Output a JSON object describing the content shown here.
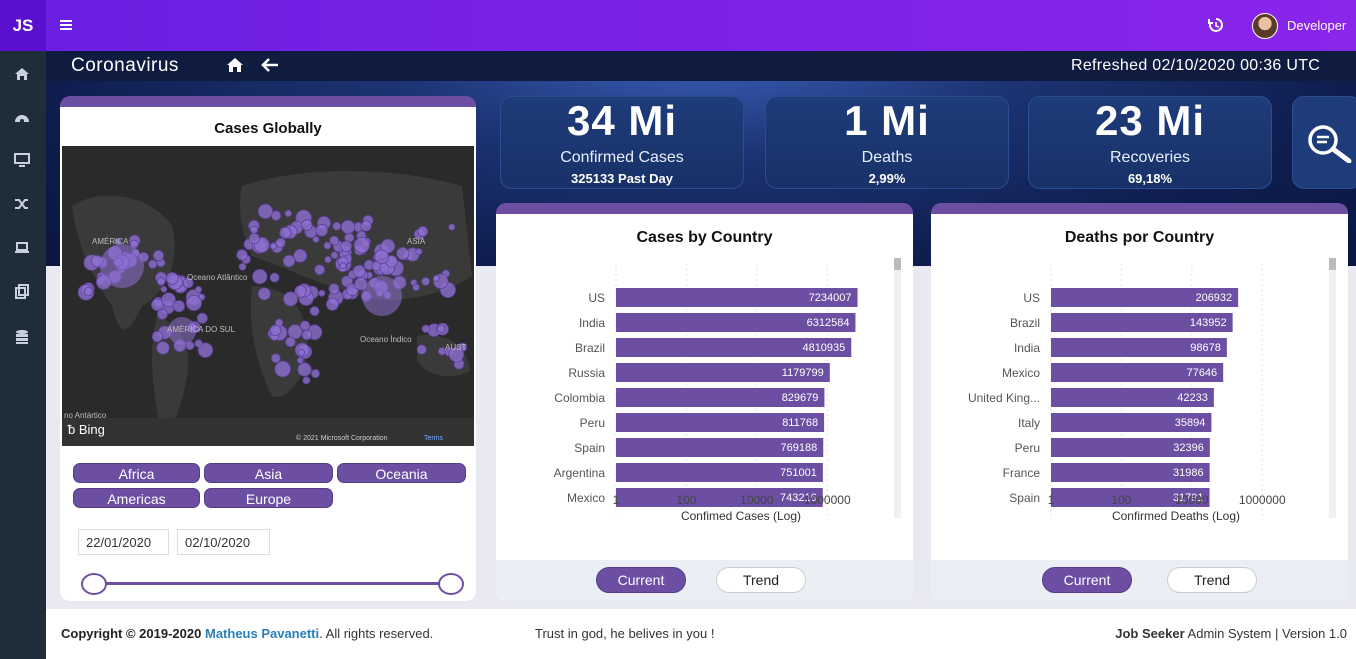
{
  "app": {
    "brand": "JS",
    "user": "Developer"
  },
  "header": {
    "title": "Coronavirus",
    "refreshed": "Refreshed  02/10/2020 00:36 UTC"
  },
  "sidebar": {
    "icons": [
      "home-icon",
      "dashboard-icon",
      "desktop-icon",
      "shuffle-icon",
      "laptop-icon",
      "copy-icon",
      "database-icon"
    ]
  },
  "stats": [
    {
      "value": "34 Mi",
      "label": "Confirmed Cases",
      "sub": "325133 Past Day"
    },
    {
      "value": "1 Mi",
      "label": "Deaths",
      "sub": "2,99%"
    },
    {
      "value": "23 Mi",
      "label": "Recoveries",
      "sub": "69,18%"
    }
  ],
  "map": {
    "title": "Cases Globally",
    "provider": "Bing",
    "copyright": "© 2021 Microsoft Corporation",
    "terms": "Terms",
    "labels": [
      "AMÉRICA",
      "Oceano Atlântico",
      "ASIA",
      "AMÉRICA DO SUL",
      "Oceano Índico",
      "AUST",
      "no Antártico"
    ]
  },
  "regions": [
    "Africa",
    "Asia",
    "Oceania",
    "Americas",
    "Europe"
  ],
  "date_range": {
    "start": "22/01/2020",
    "end": "02/10/2020"
  },
  "chart_data": [
    {
      "type": "bar",
      "title": "Cases by Country",
      "xlabel": "Confimed Cases (Log)",
      "xscale": "log",
      "xticks": [
        "1",
        "100",
        "10000",
        "1000000"
      ],
      "categories": [
        "US",
        "India",
        "Brazil",
        "Russia",
        "Colombia",
        "Peru",
        "Spain",
        "Argentina",
        "Mexico"
      ],
      "values": [
        7234007,
        6312584,
        4810935,
        1179799,
        829679,
        811768,
        769188,
        751001,
        743216
      ]
    },
    {
      "type": "bar",
      "title": "Deaths por Country",
      "xlabel": "Confirmed Deaths (Log)",
      "xscale": "log",
      "xticks": [
        "1",
        "100",
        "10000",
        "1000000"
      ],
      "categories": [
        "US",
        "Brazil",
        "India",
        "Mexico",
        "United King...",
        "Italy",
        "Peru",
        "France",
        "Spain"
      ],
      "values": [
        206932,
        143952,
        98678,
        77646,
        42233,
        35894,
        32396,
        31986,
        31791
      ]
    }
  ],
  "toggle": {
    "current": "Current",
    "trend": "Trend"
  },
  "footer": {
    "copyright_prefix": "Copyright © 2019-2020",
    "author": "Matheus Pavanetti",
    "rights": ". All rights reserved.",
    "tagline": "Trust in god, he belives in you !",
    "product": "Job Seeker",
    "system": "Admin System | Version 1.0"
  },
  "colors": {
    "accent": "#6c4ea2",
    "topbar": "#7a22e6",
    "sidebar": "#1f2c3a",
    "bubble": "#8e6fd1"
  }
}
